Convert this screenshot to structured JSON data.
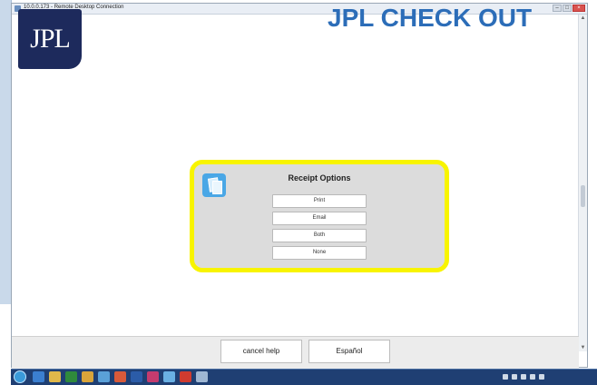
{
  "window": {
    "title": "10.0.0.173 - Remote Desktop Connection",
    "center_title": "",
    "controls": {
      "minimize": "–",
      "maximize": "□",
      "close": "×"
    }
  },
  "app": {
    "logo_text": "JPL",
    "title": "JPL CHECK OUT"
  },
  "dialog": {
    "title": "Receipt Options",
    "icon": "receipt-icon",
    "options": [
      "Print",
      "Email",
      "Both",
      "None"
    ],
    "highlight_color": "#f8f400"
  },
  "bottom": {
    "cancel_help": "cancel help",
    "espanol": "Español"
  },
  "scrollbar": {
    "up": "▲",
    "down": "▼"
  },
  "taskbar": {
    "icons": [
      "start-orb-icon",
      "ie-icon",
      "explorer-icon",
      "media-icon",
      "chrome-icon",
      "app-icon",
      "folder-icon",
      "word-icon",
      "outlook-icon",
      "remote-icon",
      "powerpoint-icon",
      "paint-icon"
    ],
    "clock_time": "",
    "clock_date": ""
  },
  "colors": {
    "accent": "#2c6db8",
    "logo_bg": "#1d2a5c",
    "highlight": "#f8f400",
    "taskbar": "#1f3f73"
  }
}
